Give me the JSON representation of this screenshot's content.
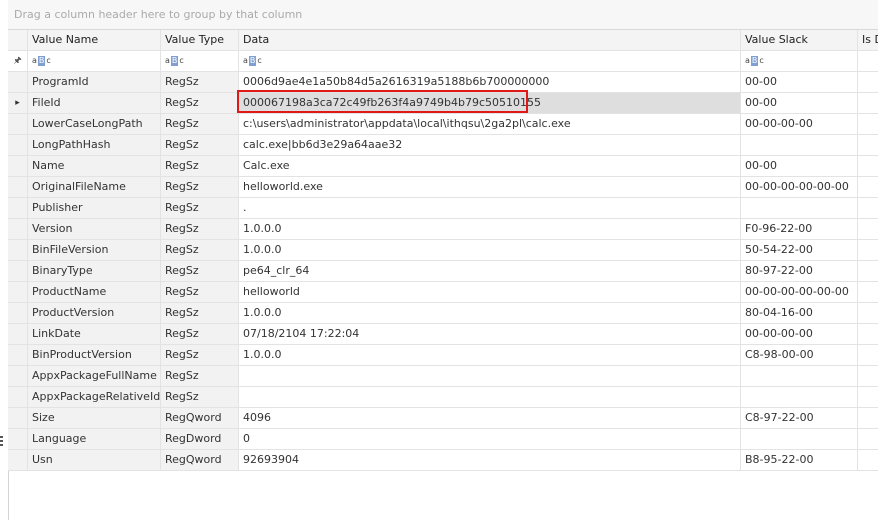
{
  "group_hint": "Drag a column header here to group by that column",
  "columns": [
    "Value Name",
    "Value Type",
    "Data",
    "Value Slack",
    "Is D"
  ],
  "filter_icon": "abc-filter-icon",
  "pin_icon": "pin-icon",
  "row_indicator_icon": "triangle-right-icon",
  "selected_row_index": 1,
  "highlight_color": "#e01818",
  "rows": [
    [
      "ProgramId",
      "RegSz",
      "0006d9ae4e1a50b84d5a2616319a5188b6b700000000",
      "00-00"
    ],
    [
      "FileId",
      "RegSz",
      "000067198a3ca72c49fb263f4a9749b4b79c50510155",
      "00-00"
    ],
    [
      "LowerCaseLongPath",
      "RegSz",
      "c:\\users\\administrator\\appdata\\local\\ithqsu\\2ga2pl\\calc.exe",
      "00-00-00-00"
    ],
    [
      "LongPathHash",
      "RegSz",
      "calc.exe|bb6d3e29a64aae32",
      ""
    ],
    [
      "Name",
      "RegSz",
      "Calc.exe",
      "00-00"
    ],
    [
      "OriginalFileName",
      "RegSz",
      "helloworld.exe",
      "00-00-00-00-00-00"
    ],
    [
      "Publisher",
      "RegSz",
      ".",
      ""
    ],
    [
      "Version",
      "RegSz",
      "1.0.0.0",
      "F0-96-22-00"
    ],
    [
      "BinFileVersion",
      "RegSz",
      "1.0.0.0",
      "50-54-22-00"
    ],
    [
      "BinaryType",
      "RegSz",
      "pe64_clr_64",
      "80-97-22-00"
    ],
    [
      "ProductName",
      "RegSz",
      "helloworld",
      "00-00-00-00-00-00"
    ],
    [
      "ProductVersion",
      "RegSz",
      "1.0.0.0",
      "80-04-16-00"
    ],
    [
      "LinkDate",
      "RegSz",
      "07/18/2104 17:22:04",
      "00-00-00-00"
    ],
    [
      "BinProductVersion",
      "RegSz",
      "1.0.0.0",
      "C8-98-00-00"
    ],
    [
      "AppxPackageFullName",
      "RegSz",
      "",
      ""
    ],
    [
      "AppxPackageRelativeId",
      "RegSz",
      "",
      ""
    ],
    [
      "Size",
      "RegQword",
      "4096",
      "C8-97-22-00"
    ],
    [
      "Language",
      "RegDword",
      "0",
      ""
    ],
    [
      "Usn",
      "RegQword",
      "92693904",
      "B8-95-22-00"
    ]
  ]
}
